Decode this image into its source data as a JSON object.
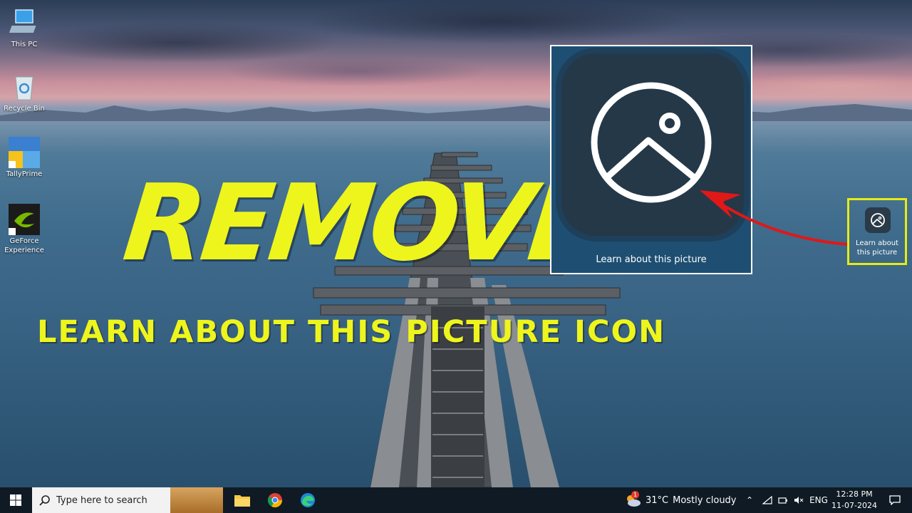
{
  "desktop": {
    "icons": [
      {
        "label": "This PC",
        "icon": "computer-icon"
      },
      {
        "label": "Recycle Bin",
        "icon": "recycle-bin-icon"
      },
      {
        "label": "TallyPrime",
        "icon": "tallyprime-icon"
      },
      {
        "label": "GeForce Experience",
        "icon": "geforce-icon"
      }
    ]
  },
  "overlay": {
    "title": "REMOVE",
    "subtitle": "LEARN ABOUT THIS PICTURE ICON",
    "accent_color": "#eef51c"
  },
  "zoom_panel": {
    "label": "Learn about this picture",
    "icon": "picture-icon"
  },
  "widget": {
    "label_line1": "Learn about",
    "label_line2": "this picture",
    "icon": "picture-icon",
    "highlight_color": "#e5ec12"
  },
  "taskbar": {
    "search_placeholder": "Type here to search",
    "apps": [
      {
        "name": "File Explorer",
        "icon": "folder-icon"
      },
      {
        "name": "Google Chrome",
        "icon": "chrome-icon"
      },
      {
        "name": "Microsoft Edge",
        "icon": "edge-icon"
      }
    ],
    "weather": {
      "badge": "1",
      "temp": "31°C",
      "condition": "Mostly cloudy"
    },
    "language": "ENG",
    "time": "12:28 PM",
    "date": "11-07-2024"
  }
}
